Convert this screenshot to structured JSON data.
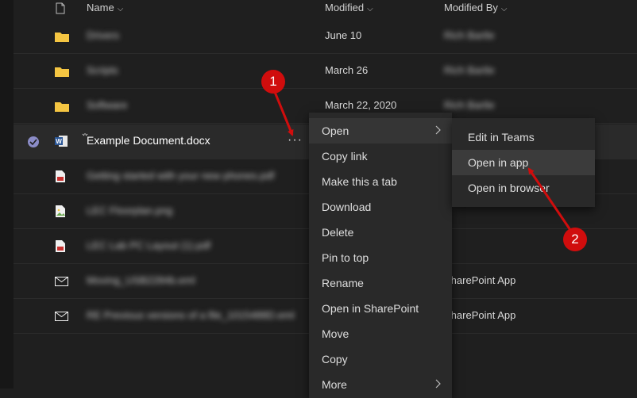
{
  "header": {
    "name_label": "Name",
    "modified_label": "Modified",
    "modified_by_label": "Modified By"
  },
  "files": [
    {
      "name": "Drivers",
      "modified": "June 10",
      "modified_by": "Rich Bartle",
      "icon": "folder-icon",
      "blurred": true
    },
    {
      "name": "Scripts",
      "modified": "March 26",
      "modified_by": "Rich Bartle",
      "icon": "folder-icon",
      "blurred": true
    },
    {
      "name": "Software",
      "modified": "March 22, 2020",
      "modified_by": "Rich Bartle",
      "icon": "folder-icon",
      "blurred": true
    },
    {
      "name": "Example Document.docx",
      "modified": "",
      "modified_by": "",
      "icon": "word-doc-icon",
      "blurred": false,
      "selected": true
    },
    {
      "name": "Getting started with your new phones.pdf",
      "modified": "",
      "modified_by": "",
      "icon": "pdf-icon",
      "blurred": true
    },
    {
      "name": "LEC Floorplan.png",
      "modified": "",
      "modified_by": "",
      "icon": "image-icon",
      "blurred": true
    },
    {
      "name": "LEC Lab PC Layout (1).pdf",
      "modified": "",
      "modified_by": "",
      "icon": "pdf-icon",
      "blurred": true
    },
    {
      "name": "Moving_USB2284b.eml",
      "modified": "",
      "modified_by": "SharePoint App",
      "icon": "mail-icon",
      "blurred": true
    },
    {
      "name": "RE Previous versions of a file_1015488D.eml",
      "modified": "",
      "modified_by": "SharePoint App",
      "icon": "mail-icon",
      "blurred": true
    }
  ],
  "more_button": "···",
  "context_menu": {
    "items": [
      "Open",
      "Copy link",
      "Make this a tab",
      "Download",
      "Delete",
      "Pin to top",
      "Rename",
      "Open in SharePoint",
      "Move",
      "Copy",
      "More"
    ]
  },
  "submenu": {
    "items": [
      "Edit in Teams",
      "Open in app",
      "Open in browser"
    ]
  },
  "annotations": {
    "badge1": "1",
    "badge2": "2",
    "color": "#d00d0d"
  },
  "colors": {
    "folder": "#f4c542",
    "check": "#8b8cc7",
    "word": "#2b5797",
    "pdf": "#c8312f"
  }
}
